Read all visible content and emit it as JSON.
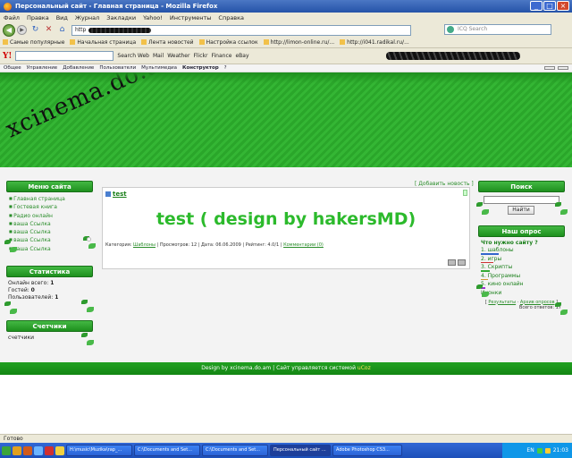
{
  "window": {
    "title": "Персональный сайт - Главная страница - Mozilla Firefox",
    "controls": [
      "_",
      "□",
      "×"
    ]
  },
  "menubar": [
    "Файл",
    "Правка",
    "Вид",
    "Журнал",
    "Закладки",
    "Yahoo!",
    "Инструменты",
    "Справка"
  ],
  "navbar": {
    "url_prefix": "http",
    "search_placeholder": "ICQ Search"
  },
  "bookmarks": [
    "Самые популярные",
    "Начальная страница",
    "Лента новостей",
    "Настройка ссылок",
    "http://limon-online.ru/...",
    "http://i041.radikal.ru/..."
  ],
  "yahoo_toolbar": {
    "logo": "Y!",
    "items": [
      "Search Web",
      "Mail",
      "Weather",
      "Flickr",
      "Finance",
      "eBay"
    ]
  },
  "adminbar": {
    "items": [
      "Общее",
      "Управление",
      "Добавление",
      "Пользователи",
      "Мультимедиа"
    ],
    "active": "Конструктор",
    "help": "?"
  },
  "site": {
    "logo": "xcinema.do.am",
    "menu_title": "Меню сайта",
    "menu_items": [
      "Главная страница",
      "Гостевая книга",
      "Радио онлайн",
      "ваша Ссылка",
      "ваша Ссылка",
      "ваша Ссылка",
      "ваша Ссылка"
    ],
    "stats_title": "Статистика",
    "stats": [
      {
        "label": "Онлайн всего:",
        "value": "1"
      },
      {
        "label": "Гостей:",
        "value": "0"
      },
      {
        "label": "Пользователей:",
        "value": "1"
      }
    ],
    "counters_title": "Счетчики",
    "counters_text": "счетчики",
    "add_news": "[ Добавить новость ]",
    "post": {
      "title": "test",
      "body": "test ( design by hakersMD)",
      "info_plain": "Категория: ",
      "category": "Шаблоны",
      "info_rest": " | Просмотров: 12 | Дата: 06.06.2009 | Рейтинг: 4.0/1 | ",
      "comments": "Комментарии (0)"
    },
    "search_title": "Поиск",
    "search_button": "Найти",
    "poll_title": "Наш опрос",
    "poll_question": "Что нужно сайту ?",
    "poll_options": [
      {
        "label": "1. шаблоны",
        "color": "#3366cc"
      },
      {
        "label": "2. игры",
        "color": "#cc3333"
      },
      {
        "label": "3. Скрипты",
        "color": "#33aa33"
      },
      {
        "label": "4. Программы",
        "color": "#cc9933"
      },
      {
        "label": "5. кино онлайн",
        "color": "#9933cc"
      },
      {
        "label": "Иконки",
        "color": ""
      }
    ],
    "poll_results": "Результаты",
    "poll_archive": "Архив опросов",
    "poll_total": "Всего ответов: 17",
    "footer_text": "Design by xcinema.do.am | Сайт управляется системой ",
    "footer_cms": "uCoz"
  },
  "status": "Готово",
  "taskbar": {
    "tasks": [
      "H:\\music\\Muzika\\rap_...",
      "C:\\Documents and Set...",
      "C:\\Documents and Set...",
      "Персональный сайт ...",
      "Adobe Photoshop CS3..."
    ],
    "lang": "EN",
    "clock": "21:03"
  },
  "colors": {
    "accent": "#2aa62a",
    "link": "#2a8d2a"
  }
}
